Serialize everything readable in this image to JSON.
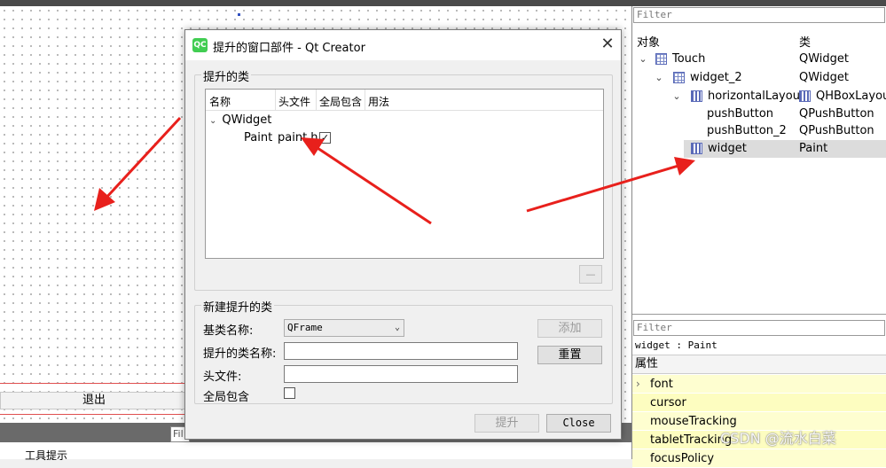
{
  "left_canvas": {
    "exit_button": "退出",
    "filter_stub": "Fil",
    "tooltip_label": "工具提示"
  },
  "object_panel": {
    "filter_placeholder": "Filter",
    "headers": {
      "object": "对象",
      "class": "类"
    },
    "rows": [
      {
        "name": "Touch",
        "cls": "QWidget",
        "icon": "grid-layout-icon",
        "expand": "chevron-down"
      },
      {
        "name": "widget_2",
        "cls": "QWidget",
        "icon": "grid-layout-icon",
        "expand": "chevron-down"
      },
      {
        "name": "horizontalLayout",
        "cls": "QHBoxLayout",
        "icon": "hbox-layout-icon",
        "expand": "chevron-down"
      },
      {
        "name": "pushButton",
        "cls": "QPushButton"
      },
      {
        "name": "pushButton_2",
        "cls": "QPushButton"
      },
      {
        "name": "widget",
        "cls": "Paint",
        "icon": "hbox-layout-icon",
        "selected": true
      }
    ]
  },
  "property_panel": {
    "filter_placeholder": "Filter",
    "current": "widget : Paint",
    "section": "属性",
    "props": [
      "font",
      "cursor",
      "mouseTracking",
      "tabletTracking",
      "focusPolicy"
    ]
  },
  "dialog": {
    "title": "提升的窗口部件 - Qt Creator",
    "logo": "QC",
    "promoted_group_title": "提升的类",
    "columns": [
      "名称",
      "头文件",
      "全局包含",
      "用法"
    ],
    "tree_parent": "QWidget",
    "tree_child": {
      "name": "Paint",
      "header": "paint.h",
      "global_include": true
    },
    "remove_button": "—",
    "new_group_title": "新建提升的类",
    "base_class_label": "基类名称:",
    "base_class_value": "QFrame",
    "promoted_name_label": "提升的类名称:",
    "header_file_label": "头文件:",
    "global_include_label": "全局包含",
    "add_button": "添加",
    "reset_button": "重置",
    "promote_button": "提升",
    "close_button": "Close"
  },
  "watermark": "CSDN @流水白菜",
  "colors": {
    "arrow": "#e8201c",
    "qt_green": "#41cd52",
    "selection": "#dcdcdc",
    "property_bg": "#fefed0"
  }
}
